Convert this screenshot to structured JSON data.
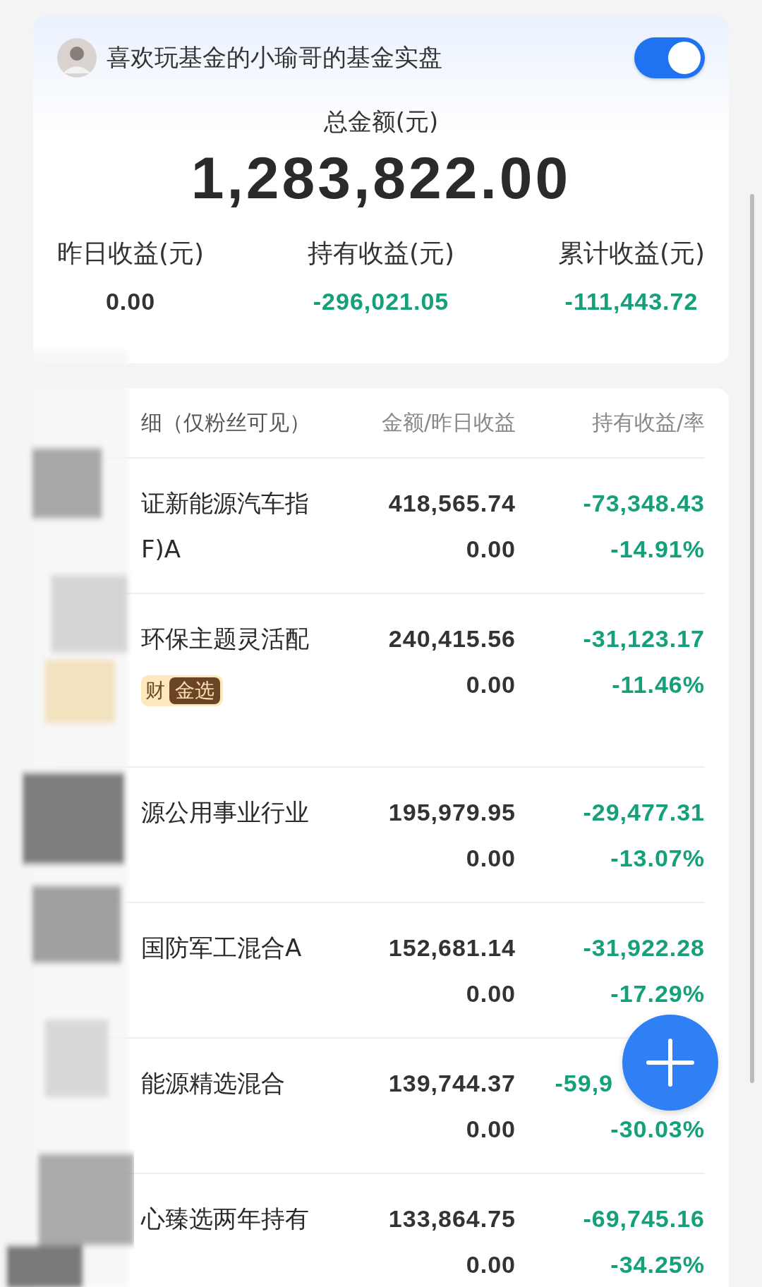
{
  "header": {
    "title": "喜欢玩基金的小瑜哥的基金实盘",
    "toggle_on": true
  },
  "total": {
    "label": "总金额(元)",
    "value": "1,283,822.00"
  },
  "stats": [
    {
      "label": "昨日收益(元)",
      "value": "0.00",
      "color": "#333333"
    },
    {
      "label": "持有收益(元)",
      "value": "-296,021.05",
      "color": "#14a07a"
    },
    {
      "label": "累计收益(元)",
      "value": "-111,443.72",
      "color": "#14a07a"
    }
  ],
  "table": {
    "columns": [
      "细（仅粉丝可见）",
      "金额/昨日收益",
      "持有收益/率"
    ],
    "rows": [
      {
        "name": [
          "证新能源汽车指",
          "F)A"
        ],
        "amount": "418,565.74",
        "yesterday": "0.00",
        "profit": "-73,348.43",
        "rate": "-14.91%"
      },
      {
        "name": [
          "环保主题灵活配"
        ],
        "tags": [
          {
            "kind": "plain",
            "text": "财"
          },
          {
            "kind": "badge",
            "text": "金选"
          }
        ],
        "amount": "240,415.56",
        "yesterday": "0.00",
        "profit": "-31,123.17",
        "rate": "-11.46%"
      },
      {
        "name": [
          "源公用事业行业"
        ],
        "amount": "195,979.95",
        "yesterday": "0.00",
        "profit": "-29,477.31",
        "rate": "-13.07%"
      },
      {
        "name": [
          "国防军工混合A"
        ],
        "amount": "152,681.14",
        "yesterday": "0.00",
        "profit": "-31,922.28",
        "rate": "-17.29%"
      },
      {
        "name": [
          "能源精选混合"
        ],
        "amount": "139,744.37",
        "yesterday": "0.00",
        "profit": "-59,9",
        "rate": "-30.03%"
      },
      {
        "name": [
          "心臻选两年持有"
        ],
        "amount": "133,864.75",
        "yesterday": "0.00",
        "profit": "-69,745.16",
        "rate": "-34.25%"
      }
    ]
  }
}
